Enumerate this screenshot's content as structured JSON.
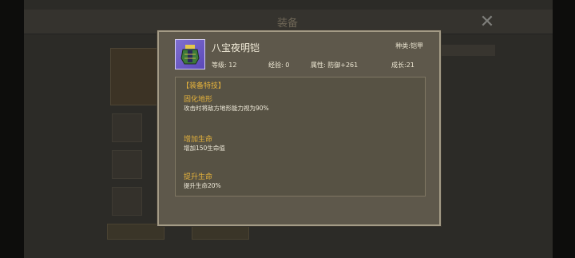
{
  "background": {
    "window_title": "装备",
    "close_symbol": "✕"
  },
  "item": {
    "name": "八宝夜明铠",
    "type_text": "种类:铠甲",
    "level_text": "等级: 12",
    "exp_text": "经验: 0",
    "attribute_text": "属性: 防御+261",
    "growth_text": "成长:21",
    "icon": "armor-icon",
    "icon_color": "#6a56c4"
  },
  "skills": {
    "heading": "【装备特技】",
    "items": [
      {
        "title": "固化地形",
        "desc": "攻击时将敌方地形能力视为90%"
      },
      {
        "title": "增加生命",
        "desc": "增加150生命值"
      },
      {
        "title": "提升生命",
        "desc": "提升生命20%"
      }
    ]
  },
  "colors": {
    "accent": "#e6b33c",
    "panel_bg": "#5e584b",
    "panel_border": "#a49b86"
  }
}
